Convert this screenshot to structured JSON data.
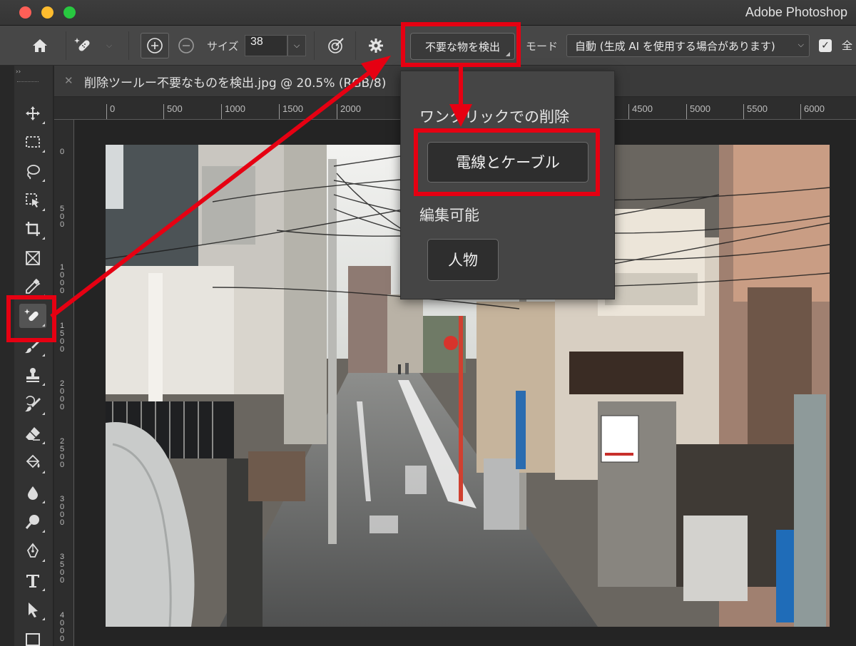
{
  "window": {
    "app_title": "Adobe Photoshop"
  },
  "options_bar": {
    "size_label": "サイズ",
    "size_value": "38",
    "detect_button_label": "不要な物を検出",
    "mode_label": "モード",
    "mode_value": "自動 (生成 AI を使用する場合があります)",
    "all_layers_label": "全",
    "all_layers_checked": true
  },
  "document": {
    "tab_title": "削除ツールー不要なものを検出.jpg @ 20.5% (RGB/8)"
  },
  "ruler": {
    "horizontal_ticks": [
      "0",
      "500",
      "1000",
      "1500",
      "2000",
      "4500",
      "5000",
      "5500",
      "6000"
    ],
    "vertical_ticks": [
      "0",
      "500",
      "1000",
      "1500",
      "2000",
      "2500",
      "3000",
      "3500",
      "4000"
    ]
  },
  "popup": {
    "oneclick_heading": "ワンクリックでの削除",
    "wires_button": "電線とケーブル",
    "editable_heading": "編集可能",
    "people_button": "人物"
  },
  "toolbar": {
    "tools": [
      "move",
      "marquee",
      "lasso",
      "object-selection",
      "crop",
      "frame",
      "eyedropper",
      "remove",
      "brush",
      "clone-stamp",
      "history-brush",
      "eraser",
      "paint-bucket",
      "blur",
      "dodge",
      "pen",
      "type",
      "path-selection",
      "rectangle"
    ],
    "active_tool": "remove"
  },
  "colors": {
    "highlight": "#e60012",
    "panel": "#454545",
    "options_bar": "#474747"
  }
}
